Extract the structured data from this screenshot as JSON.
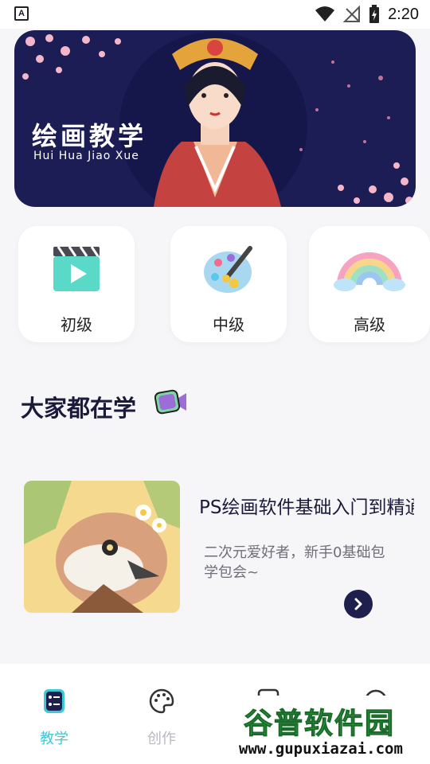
{
  "status": {
    "time": "2:20",
    "left_badge": "A"
  },
  "banner": {
    "title": "绘画教学",
    "subtitle": "Hui Hua Jiao Xue"
  },
  "levels": [
    {
      "label": "初级",
      "icon": "video-clapper-icon"
    },
    {
      "label": "中级",
      "icon": "palette-icon"
    },
    {
      "label": "高级",
      "icon": "rainbow-icon"
    }
  ],
  "section": {
    "title": "大家都在学",
    "icon": "camera-icon"
  },
  "course": {
    "title": "PS绘画软件基础入门到精通",
    "description": "二次元爱好者，新手0基础包学包会~"
  },
  "tabs": [
    {
      "label": "教学",
      "icon": "teach-icon",
      "active": true
    },
    {
      "label": "创作",
      "icon": "palette-icon",
      "active": false
    },
    {
      "label": "",
      "icon": "image-icon",
      "active": false
    },
    {
      "label": "",
      "icon": "profile-icon",
      "active": false
    }
  ],
  "watermark": {
    "main": "谷普软件园",
    "sub": "www.gupuxiazai.com"
  },
  "colors": {
    "accent": "#3ec8d6",
    "banner_bg": "#1c1d55",
    "dark_button": "#1f1f4e"
  }
}
